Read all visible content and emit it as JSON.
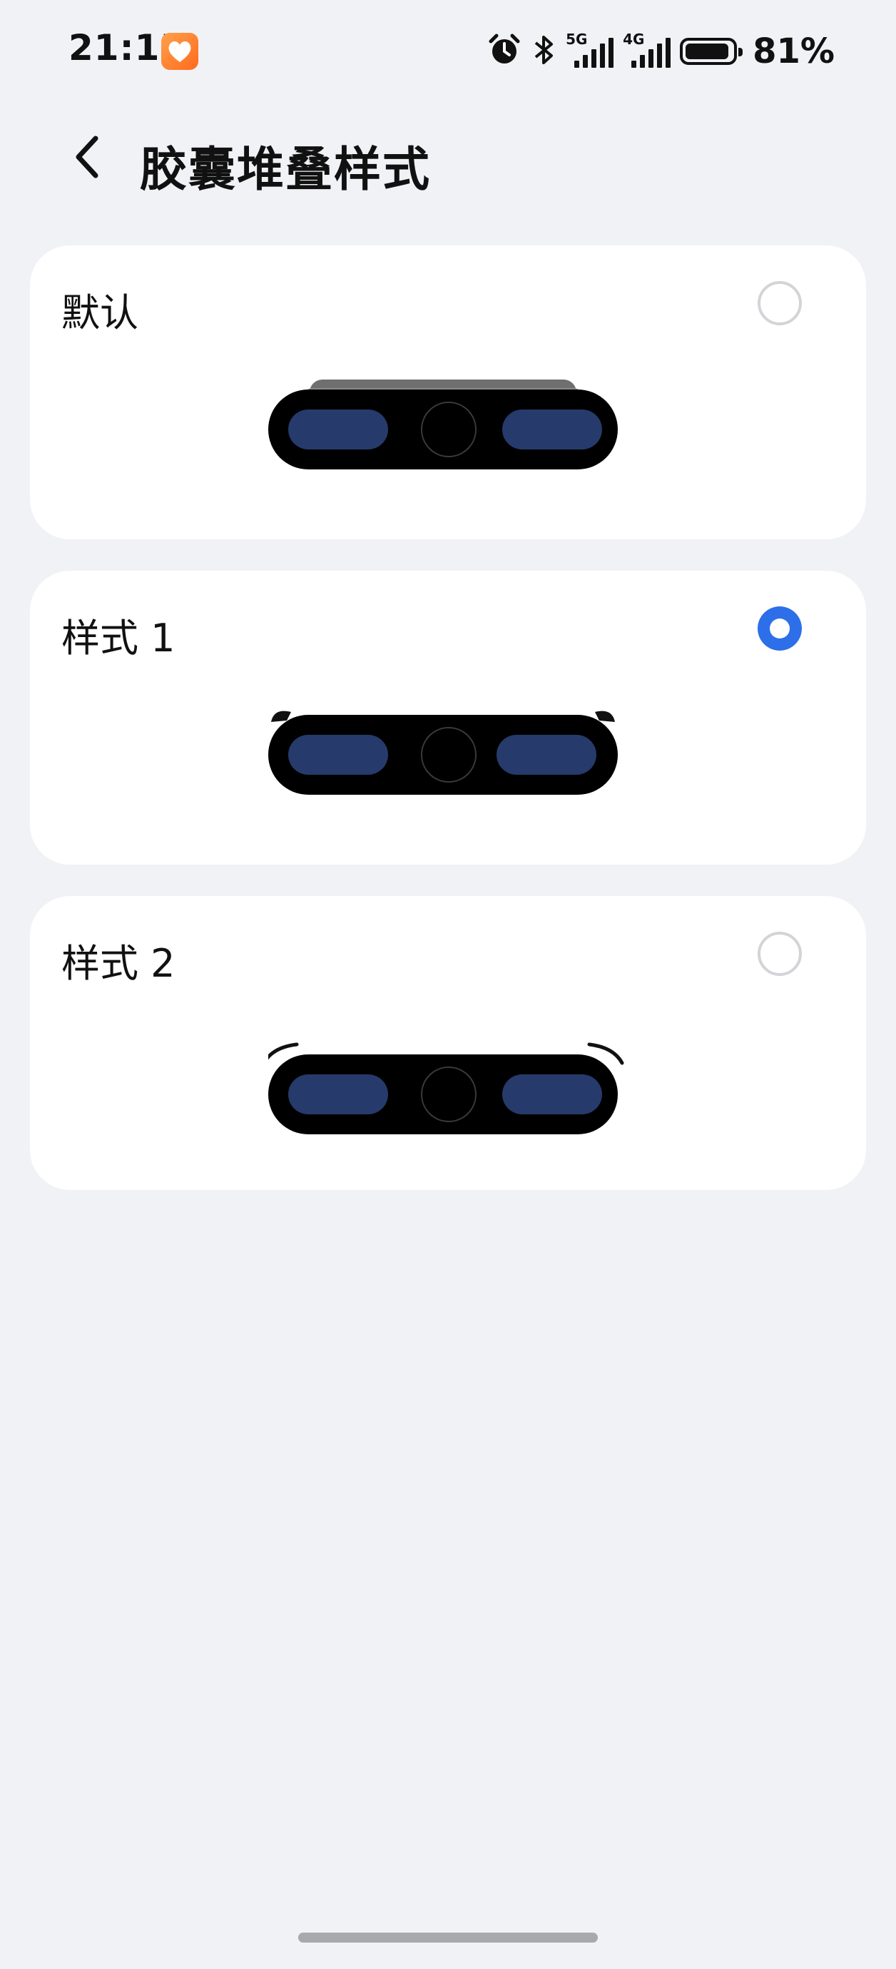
{
  "status_bar": {
    "time": "21:15",
    "signal1_label": "5G",
    "signal2_label": "4G",
    "battery_percent": "81%",
    "battery_level": 0.81,
    "icons": [
      "heart-app-icon",
      "alarm-icon",
      "bluetooth-icon",
      "signal-5g-icon",
      "signal-4g-icon",
      "battery-icon"
    ]
  },
  "header": {
    "title": "胶囊堆叠样式",
    "back_icon": "chevron-left-icon"
  },
  "options": [
    {
      "label": "默认",
      "selected": false,
      "preview": "default"
    },
    {
      "label": "样式 1",
      "selected": true,
      "preview": "style1"
    },
    {
      "label": "样式 2",
      "selected": false,
      "preview": "style2"
    }
  ],
  "colors": {
    "accent": "#2d6fe8",
    "background": "#f1f2f6",
    "capsule": "#000000",
    "pill": "#263a6b"
  }
}
